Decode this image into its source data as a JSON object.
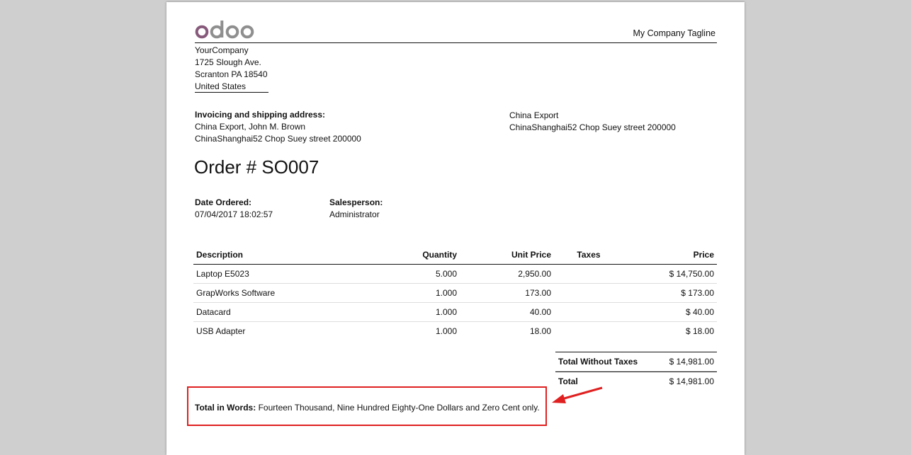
{
  "header": {
    "logo_text": "odoo",
    "tagline": "My Company Tagline"
  },
  "company": {
    "name": "YourCompany",
    "street": "1725 Slough Ave.",
    "city_line": "Scranton PA 18540",
    "country": "United States"
  },
  "billing": {
    "heading": "Invoicing and shipping address:",
    "name_line": "China Export, John M. Brown",
    "address_line": "ChinaShanghai52 Chop Suey street 200000"
  },
  "customer": {
    "name": "China Export",
    "address_line": "ChinaShanghai52 Chop Suey street 200000"
  },
  "order": {
    "title": "Order # SO007",
    "date_label": "Date Ordered:",
    "date_value": "07/04/2017 18:02:57",
    "salesperson_label": "Salesperson:",
    "salesperson_value": "Administrator"
  },
  "table": {
    "headers": [
      "Description",
      "Quantity",
      "Unit Price",
      "Taxes",
      "Price"
    ],
    "rows": [
      [
        "Laptop E5023",
        "5.000",
        "2,950.00",
        "",
        "$ 14,750.00"
      ],
      [
        "GrapWorks Software",
        "1.000",
        "173.00",
        "",
        "$ 173.00"
      ],
      [
        "Datacard",
        "1.000",
        "40.00",
        "",
        "$ 40.00"
      ],
      [
        "USB Adapter",
        "1.000",
        "18.00",
        "",
        "$ 18.00"
      ]
    ]
  },
  "totals": {
    "subtotal_label": "Total Without Taxes",
    "subtotal_value": "$ 14,981.00",
    "total_label": "Total",
    "total_value": "$ 14,981.00"
  },
  "words": {
    "label": "Total in Words:",
    "text": "Fourteen Thousand, Nine Hundred Eighty-One Dollars and Zero Cent only."
  },
  "colors": {
    "background": "#cfcfcf",
    "logo_purple": "#875a7b",
    "logo_gray": "#8f8f8f",
    "highlight_red": "#e02020"
  }
}
